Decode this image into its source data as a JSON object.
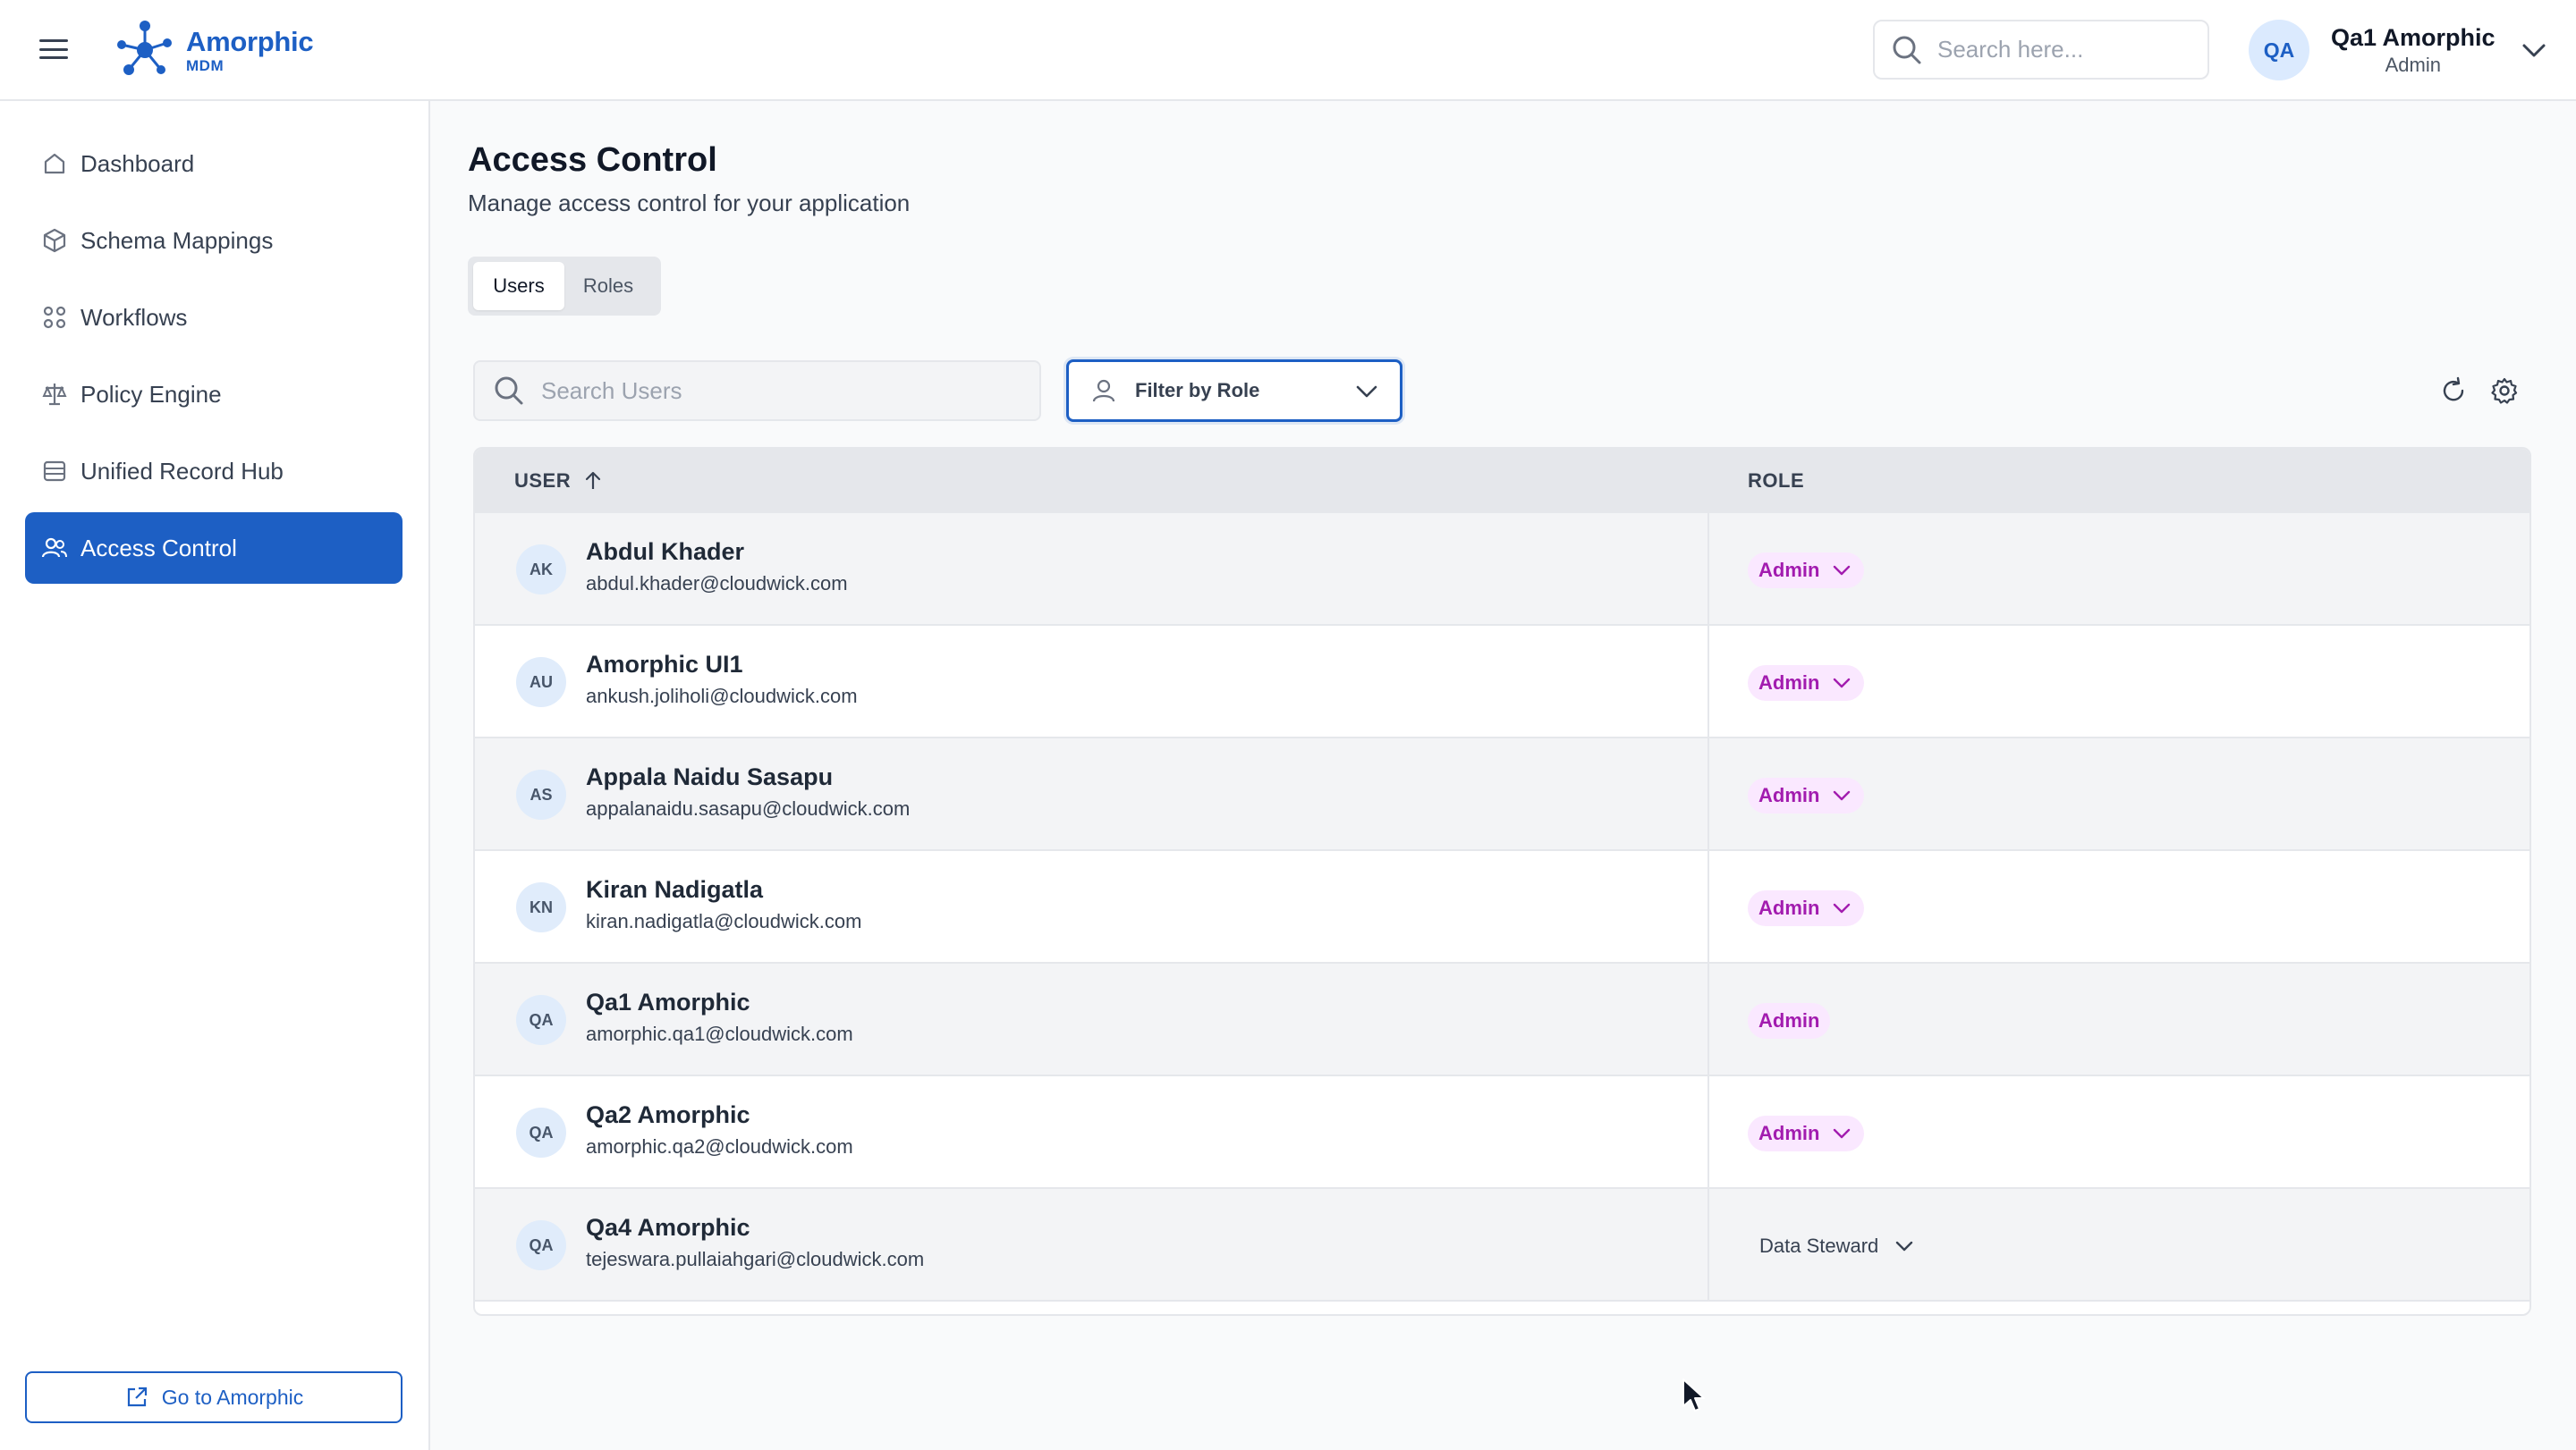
{
  "app": {
    "name": "Amorphic",
    "sub": "MDM"
  },
  "header": {
    "search_placeholder": "Search here...",
    "user": {
      "initials": "QA",
      "name": "Qa1 Amorphic",
      "role": "Admin"
    }
  },
  "sidebar": {
    "items": [
      {
        "label": "Dashboard",
        "icon": "home-icon"
      },
      {
        "label": "Schema Mappings",
        "icon": "cube-icon"
      },
      {
        "label": "Workflows",
        "icon": "workflow-icon"
      },
      {
        "label": "Policy Engine",
        "icon": "scale-icon"
      },
      {
        "label": "Unified Record Hub",
        "icon": "database-icon"
      },
      {
        "label": "Access Control",
        "icon": "users-icon",
        "active": true
      }
    ],
    "go_button": "Go to Amorphic"
  },
  "main": {
    "title": "Access Control",
    "subtitle": "Manage access control for your application",
    "tabs": [
      {
        "label": "Users",
        "active": true
      },
      {
        "label": "Roles"
      }
    ],
    "search_placeholder": "Search Users",
    "filter_label": "Filter by Role",
    "table": {
      "columns": [
        "USER",
        "ROLE"
      ],
      "sort": "ascending",
      "rows": [
        {
          "initials": "AK",
          "name": "Abdul Khader",
          "email": "abdul.khader@cloudwick.com",
          "role": "Admin",
          "editable": true
        },
        {
          "initials": "AU",
          "name": "Amorphic UI1",
          "email": "ankush.joliholi@cloudwick.com",
          "role": "Admin",
          "editable": true
        },
        {
          "initials": "AS",
          "name": "Appala Naidu Sasapu",
          "email": "appalanaidu.sasapu@cloudwick.com",
          "role": "Admin",
          "editable": true
        },
        {
          "initials": "KN",
          "name": "Kiran Nadigatla",
          "email": "kiran.nadigatla@cloudwick.com",
          "role": "Admin",
          "editable": true
        },
        {
          "initials": "QA",
          "name": "Qa1 Amorphic",
          "email": "amorphic.qa1@cloudwick.com",
          "role": "Admin",
          "editable": false
        },
        {
          "initials": "QA",
          "name": "Qa2 Amorphic",
          "email": "amorphic.qa2@cloudwick.com",
          "role": "Admin",
          "editable": true
        },
        {
          "initials": "QA",
          "name": "Qa4 Amorphic",
          "email": "tejeswara.pullaiahgari@cloudwick.com",
          "role": "Data Steward",
          "editable": true
        }
      ]
    }
  },
  "colors": {
    "accent": "#1d5fc4",
    "badge_bg": "#fae8ff",
    "badge_text": "#a21caf"
  }
}
